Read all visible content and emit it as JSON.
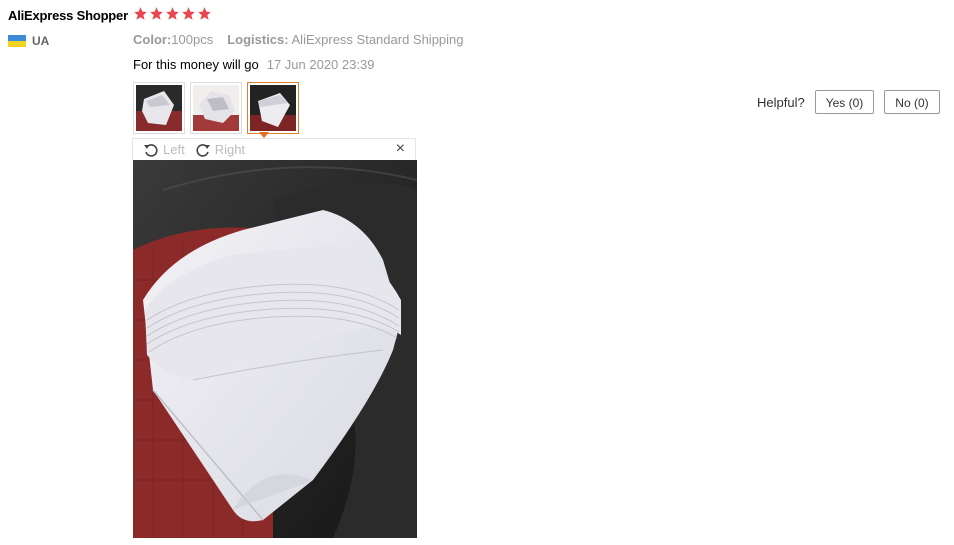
{
  "user": {
    "name": "AliExpress Shopper",
    "country": "UA",
    "flag_colors": [
      "#3b8bd8",
      "#f5d21f"
    ]
  },
  "rating": {
    "stars": 5,
    "max": 5,
    "color": "#e8474f"
  },
  "meta": {
    "color_label": "Color:",
    "color_value": "100pcs",
    "logistics_label": "Logistics:",
    "logistics_value": "AliExpress Standard Shipping"
  },
  "review": {
    "text": "For this money will go",
    "date": "17 Jun 2020 23:39"
  },
  "thumbnails": [
    {
      "name": "photo-1",
      "active": false
    },
    {
      "name": "photo-2",
      "active": false
    },
    {
      "name": "photo-3",
      "active": true
    }
  ],
  "helpful": {
    "label": "Helpful?",
    "yes_label": "Yes (0)",
    "no_label": "No (0)"
  },
  "viewer": {
    "rotate_left_label": "Left",
    "rotate_right_label": "Right",
    "close_symbol": "×"
  },
  "colors": {
    "active_thumb_border": "#d9822b",
    "caret": "#e66a1f"
  }
}
